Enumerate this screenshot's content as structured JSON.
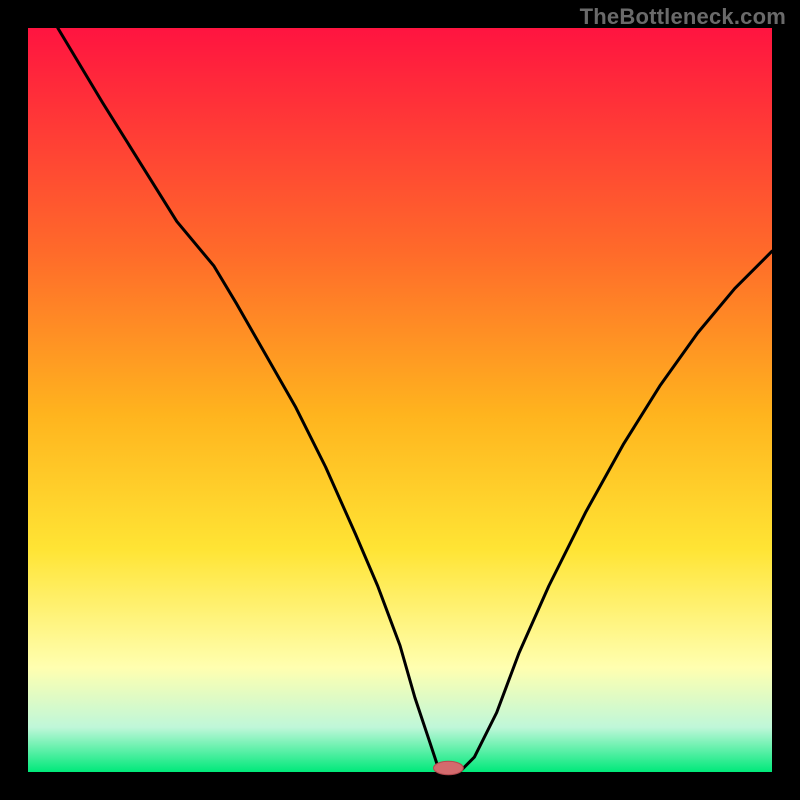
{
  "watermark": "TheBottleneck.com",
  "colors": {
    "bg": "#000000",
    "grad_top": "#ff1440",
    "grad_mid1": "#ff6a2a",
    "grad_mid2": "#ffb41e",
    "grad_mid3": "#ffe434",
    "grad_band": "#ffffb0",
    "grad_bottom_pale": "#bff7d9",
    "grad_bottom": "#00e97a",
    "curve": "#000000",
    "marker_fill": "#d36a6d",
    "marker_stroke": "#b44a4f"
  },
  "chart_data": {
    "type": "line",
    "title": "",
    "xlabel": "",
    "ylabel": "",
    "xlim": [
      0,
      100
    ],
    "ylim": [
      0,
      100
    ],
    "notes": "Area chart with vertical rainbow gradient (red top → green bottom). A single dark V-shaped curve indicating bottleneck mismatch; minimum occurs around x≈56. Small rounded marker sits at the minimum on the baseline.",
    "series": [
      {
        "name": "bottleneck-curve",
        "x": [
          4,
          10,
          15,
          20,
          25,
          28,
          32,
          36,
          40,
          44,
          47,
          50,
          52,
          54,
          55,
          56,
          58,
          60,
          63,
          66,
          70,
          75,
          80,
          85,
          90,
          95,
          100
        ],
        "y": [
          100,
          90,
          82,
          74,
          68,
          63,
          56,
          49,
          41,
          32,
          25,
          17,
          10,
          4,
          1,
          0,
          0,
          2,
          8,
          16,
          25,
          35,
          44,
          52,
          59,
          65,
          70
        ]
      }
    ],
    "marker": {
      "x": 56.5,
      "y": 0,
      "rx": 2.0,
      "ry": 0.9
    }
  }
}
